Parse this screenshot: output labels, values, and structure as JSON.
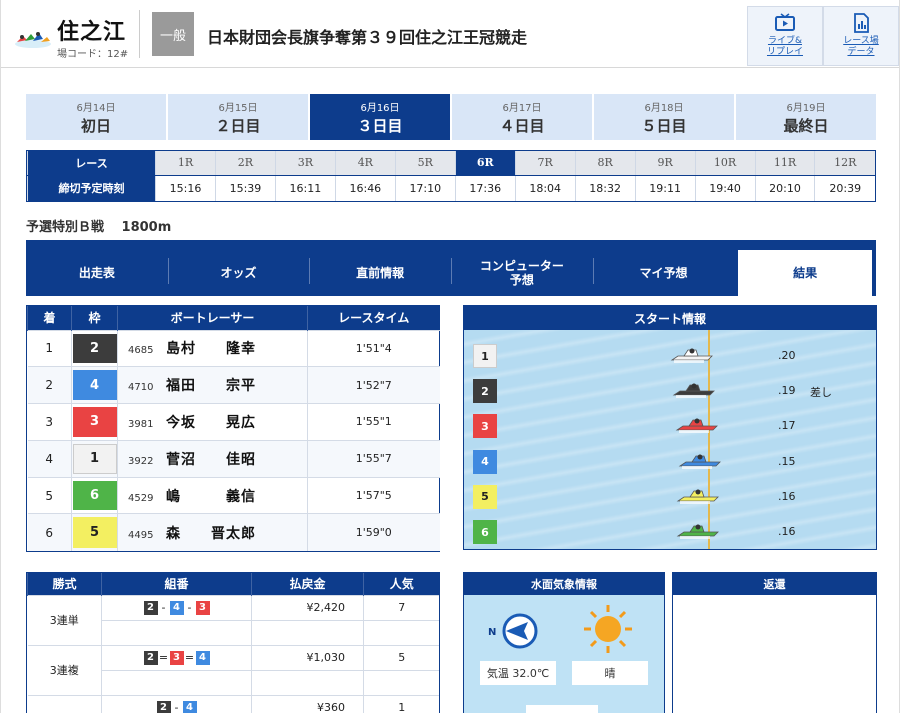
{
  "header": {
    "venue": "住之江",
    "venue_code": "場コード：12#",
    "grade": "一般",
    "race_title": "日本財団会長旗争奪第３９回住之江王冠競走",
    "buttons": [
      {
        "label": "ライブ&\nリプレイ",
        "icon": "tv-play-icon"
      },
      {
        "label": "レース場\nデータ",
        "icon": "bar-chart-doc-icon"
      }
    ]
  },
  "days": [
    {
      "date": "6月14日",
      "name": "初日",
      "active": false
    },
    {
      "date": "6月15日",
      "name": "２日目",
      "active": false
    },
    {
      "date": "6月16日",
      "name": "３日目",
      "active": true
    },
    {
      "date": "6月17日",
      "name": "４日目",
      "active": false
    },
    {
      "date": "6月18日",
      "name": "５日目",
      "active": false
    },
    {
      "date": "6月19日",
      "name": "最終日",
      "active": false
    }
  ],
  "race_grid": {
    "row1_label": "レース",
    "row2_label": "締切予定時刻",
    "races": [
      "1R",
      "2R",
      "3R",
      "4R",
      "5R",
      "6R",
      "7R",
      "8R",
      "9R",
      "10R",
      "11R",
      "12R"
    ],
    "times": [
      "15:16",
      "15:39",
      "16:11",
      "16:46",
      "17:10",
      "17:36",
      "18:04",
      "18:32",
      "19:11",
      "19:40",
      "20:10",
      "20:39"
    ],
    "current": "6R"
  },
  "subtitle": "予選特別Ｂ戦　 1800m",
  "nav": {
    "items": [
      "出走表",
      "オッズ",
      "直前情報",
      "コンピューター\n予想",
      "マイ予想",
      "結果"
    ],
    "active": "結果"
  },
  "results": {
    "headers": [
      "着",
      "枠",
      "ボートレーサー",
      "レースタイム"
    ],
    "rows": [
      {
        "place": "1",
        "frame": "2",
        "reg": "4685",
        "name": "島村　　隆幸",
        "time": "1'51\"4"
      },
      {
        "place": "2",
        "frame": "4",
        "reg": "4710",
        "name": "福田　　宗平",
        "time": "1'52\"7"
      },
      {
        "place": "3",
        "frame": "3",
        "reg": "3981",
        "name": "今坂　　晃広",
        "time": "1'55\"1"
      },
      {
        "place": "4",
        "frame": "1",
        "reg": "3922",
        "name": "菅沼　　佳昭",
        "time": "1'55\"7"
      },
      {
        "place": "5",
        "frame": "6",
        "reg": "4529",
        "name": "嶋　　　義信",
        "time": "1'57\"5"
      },
      {
        "place": "6",
        "frame": "5",
        "reg": "4495",
        "name": "森　　晋太郎",
        "time": "1'59\"0"
      }
    ]
  },
  "start_info": {
    "title": "スタート情報",
    "rows": [
      {
        "course": "1",
        "st": ".20",
        "note": ""
      },
      {
        "course": "2",
        "st": ".19",
        "note": "差し"
      },
      {
        "course": "3",
        "st": ".17",
        "note": ""
      },
      {
        "course": "4",
        "st": ".15",
        "note": ""
      },
      {
        "course": "5",
        "st": ".16",
        "note": ""
      },
      {
        "course": "6",
        "st": ".16",
        "note": ""
      }
    ]
  },
  "payout": {
    "headers": [
      "勝式",
      "組番",
      "払戻金",
      "人気"
    ],
    "rows": [
      {
        "type": "3連単",
        "combo": [
          "2",
          "4",
          "3"
        ],
        "seps": [
          "-",
          "-"
        ],
        "amount": "¥2,420",
        "pop": "7"
      },
      {
        "type": "3連複",
        "combo": [
          "2",
          "3",
          "4"
        ],
        "seps": [
          "=",
          "="
        ],
        "amount": "¥1,030",
        "pop": "5"
      },
      {
        "type": "",
        "combo": [
          "2",
          "4"
        ],
        "seps": [
          "-"
        ],
        "amount": "¥360",
        "pop": "1"
      }
    ]
  },
  "weather": {
    "title": "水面気象情報",
    "wind_dir_label": "N",
    "temp": "気温 32.0℃",
    "condition": "晴"
  },
  "refund": {
    "title": "返還"
  },
  "colors": {
    "navy": "#0d3c8c",
    "frame1": "#f2f2f2",
    "frame2": "#3c3c3c",
    "frame3": "#e94343",
    "frame4": "#3f8ae0",
    "frame5": "#f3ef61",
    "frame6": "#4fb448"
  }
}
